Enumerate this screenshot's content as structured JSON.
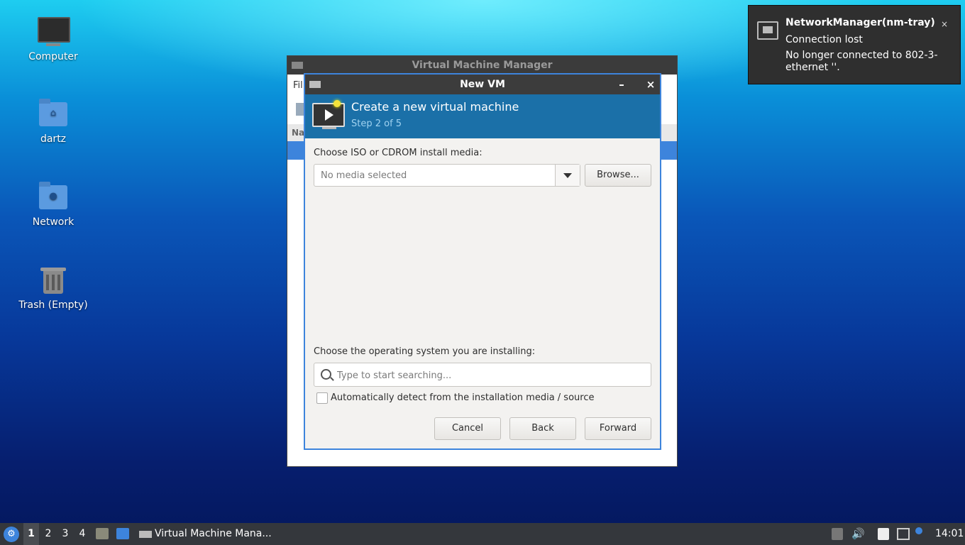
{
  "desktop": {
    "icons": [
      {
        "label": "Computer"
      },
      {
        "label": "dartz"
      },
      {
        "label": "Network"
      },
      {
        "label": "Trash (Empty)"
      }
    ]
  },
  "background_window": {
    "title": "Virtual Machine Manager",
    "menu_label": "Fil",
    "column_label": "Na"
  },
  "dialog": {
    "title": "New VM",
    "minimize": "–",
    "close": "×",
    "header_title": "Create a new virtual machine",
    "header_step": "Step 2 of 5",
    "media_label": "Choose ISO or CDROM install media:",
    "media_value": "No media selected",
    "browse_label": "Browse...",
    "os_label": "Choose the operating system you are installing:",
    "os_search_placeholder": "Type to start searching...",
    "auto_detect_label": "Automatically detect from the installation media / source",
    "auto_detect_checked": false,
    "cancel_label": "Cancel",
    "back_label": "Back",
    "forward_label": "Forward",
    "accent_color": "#1b70a8"
  },
  "notification": {
    "app": "NetworkManager(nm-tray)",
    "summary": "Connection lost",
    "body": "No longer connected to 802-3-ethernet ''.",
    "close": "×"
  },
  "taskbar": {
    "menu_glyph": "⚙",
    "workspaces": [
      "1",
      "2",
      "3",
      "4"
    ],
    "active_workspace": "1",
    "task_label": "Virtual Machine Mana...",
    "clock": "14:01"
  }
}
